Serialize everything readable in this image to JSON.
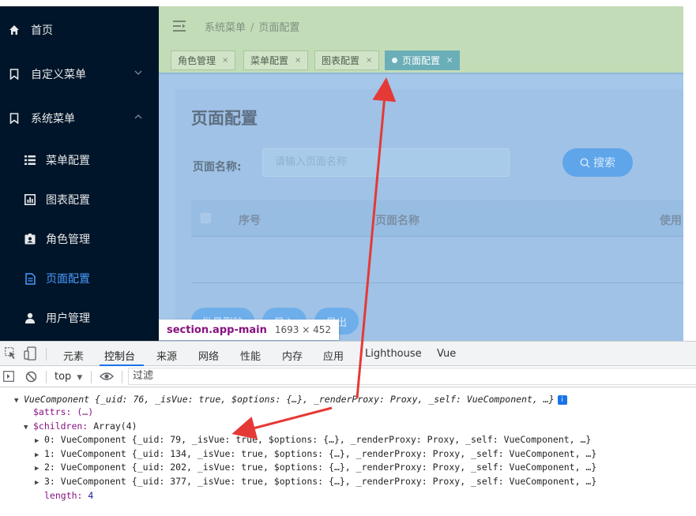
{
  "sidebar": {
    "items": [
      {
        "label": "首页",
        "icon": "home-icon"
      },
      {
        "label": "自定义菜单",
        "icon": "bookmark-icon",
        "chevron": "down"
      },
      {
        "label": "系统菜单",
        "icon": "bookmark-icon",
        "chevron": "up"
      },
      {
        "label": "菜单配置",
        "icon": "list-icon"
      },
      {
        "label": "图表配置",
        "icon": "chart-icon"
      },
      {
        "label": "角色管理",
        "icon": "id-card-icon"
      },
      {
        "label": "页面配置",
        "icon": "document-icon",
        "active": true
      },
      {
        "label": "用户管理",
        "icon": "user-icon"
      }
    ]
  },
  "header": {
    "breadcrumb": [
      "系统菜单",
      "页面配置"
    ],
    "breadcrumb_sep": "/"
  },
  "tags": [
    {
      "label": "角色管理",
      "close": "×"
    },
    {
      "label": "菜单配置",
      "close": "×"
    },
    {
      "label": "图表配置",
      "close": "×"
    },
    {
      "label": "页面配置",
      "close": "×",
      "active": true
    }
  ],
  "main": {
    "title": "页面配置",
    "search_label": "页面名称:",
    "search_placeholder": "请输入页面名称",
    "search_button": "搜索",
    "table_headers": [
      "序号",
      "页面名称",
      "使用"
    ],
    "actions": [
      "批量删除",
      "导入",
      "导出"
    ]
  },
  "tooltip": {
    "selector": "section.app-main",
    "size": "1693 × 452"
  },
  "devtools": {
    "tabs": [
      "元素",
      "控制台",
      "来源",
      "网络",
      "性能",
      "内存",
      "应用",
      "Lighthouse",
      "Vue"
    ],
    "active_tab": "控制台",
    "context": "top",
    "filter_placeholder": "过滤",
    "console_lines": {
      "root": "VueComponent {_uid: 76, _isVue: true, $options: {…}, _renderProxy: Proxy, _self: VueComponent, …}",
      "attrs": "$attrs: (…)",
      "children_key": "$children:",
      "children_val": "Array(4)",
      "child0": "0: VueComponent {_uid: 79, _isVue: true, $options: {…}, _renderProxy: Proxy, _self: VueComponent, …}",
      "child1": "1: VueComponent {_uid: 134, _isVue: true, $options: {…}, _renderProxy: Proxy, _self: VueComponent, …}",
      "child2": "2: VueComponent {_uid: 202, _isVue: true, $options: {…}, _renderProxy: Proxy, _self: VueComponent, …}",
      "child3": "3: VueComponent {_uid: 377, _isVue: true, $options: {…}, _renderProxy: Proxy, _self: VueComponent, …}",
      "length_key": "length:",
      "length_val": "4"
    }
  },
  "colors": {
    "sidebar_bg": "#001529",
    "active_menu": "#4a9bff",
    "arrow": "#e53935",
    "devtools_accent": "#1a73e8"
  }
}
